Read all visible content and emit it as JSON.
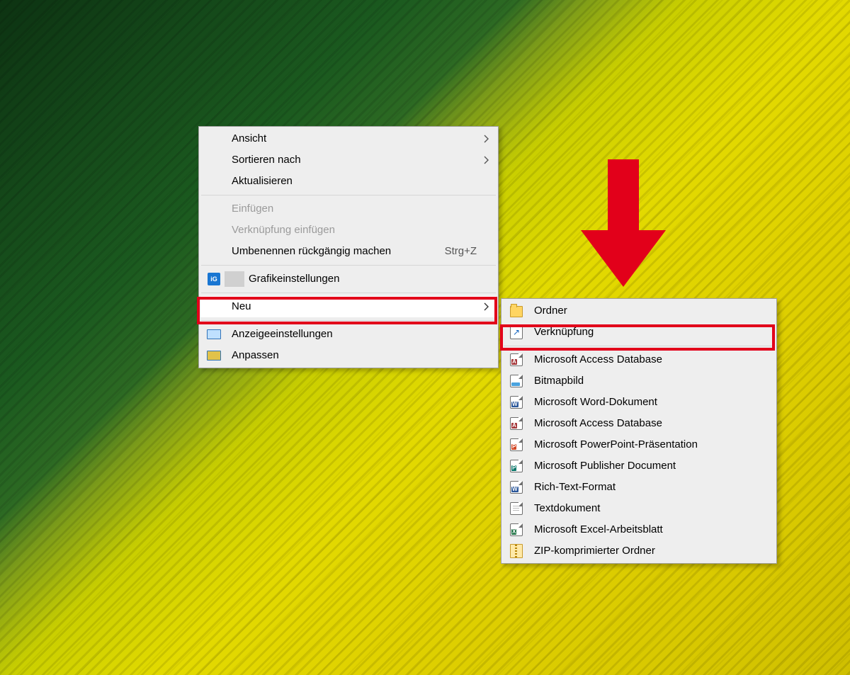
{
  "context_menu": {
    "items": [
      {
        "label": "Ansicht",
        "has_submenu": true
      },
      {
        "label": "Sortieren nach",
        "has_submenu": true
      },
      {
        "label": "Aktualisieren"
      }
    ],
    "items2": [
      {
        "label": "Einfügen",
        "disabled": true
      },
      {
        "label": "Verknüpfung einfügen",
        "disabled": true
      },
      {
        "label": "Umbenennen rückgängig machen",
        "shortcut": "Strg+Z"
      }
    ],
    "graphics_label": "Grafikeinstellungen",
    "new_label": "Neu",
    "display_label": "Anzeigeeinstellungen",
    "personalize_label": "Anpassen"
  },
  "submenu_new": {
    "folder": "Ordner",
    "shortcut": "Verknüpfung",
    "items": [
      {
        "label": "Microsoft Access Database",
        "tag": "A",
        "color": "#a4373a"
      },
      {
        "label": "Bitmapbild",
        "tag": "",
        "color": "#4aa3df"
      },
      {
        "label": "Microsoft Word-Dokument",
        "tag": "W",
        "color": "#2b579a"
      },
      {
        "label": "Microsoft Access Database",
        "tag": "A",
        "color": "#a4373a"
      },
      {
        "label": "Microsoft PowerPoint-Präsentation",
        "tag": "P",
        "color": "#d24726"
      },
      {
        "label": "Microsoft Publisher Document",
        "tag": "P",
        "color": "#077568"
      },
      {
        "label": "Rich-Text-Format",
        "tag": "W",
        "color": "#2b579a"
      },
      {
        "label": "Textdokument",
        "tag": "",
        "color": "#9e9e9e"
      },
      {
        "label": "Microsoft Excel-Arbeitsblatt",
        "tag": "X",
        "color": "#217346"
      },
      {
        "label": "ZIP-komprimierter Ordner",
        "tag": "ZIP",
        "color": "#c99a2a"
      }
    ]
  }
}
